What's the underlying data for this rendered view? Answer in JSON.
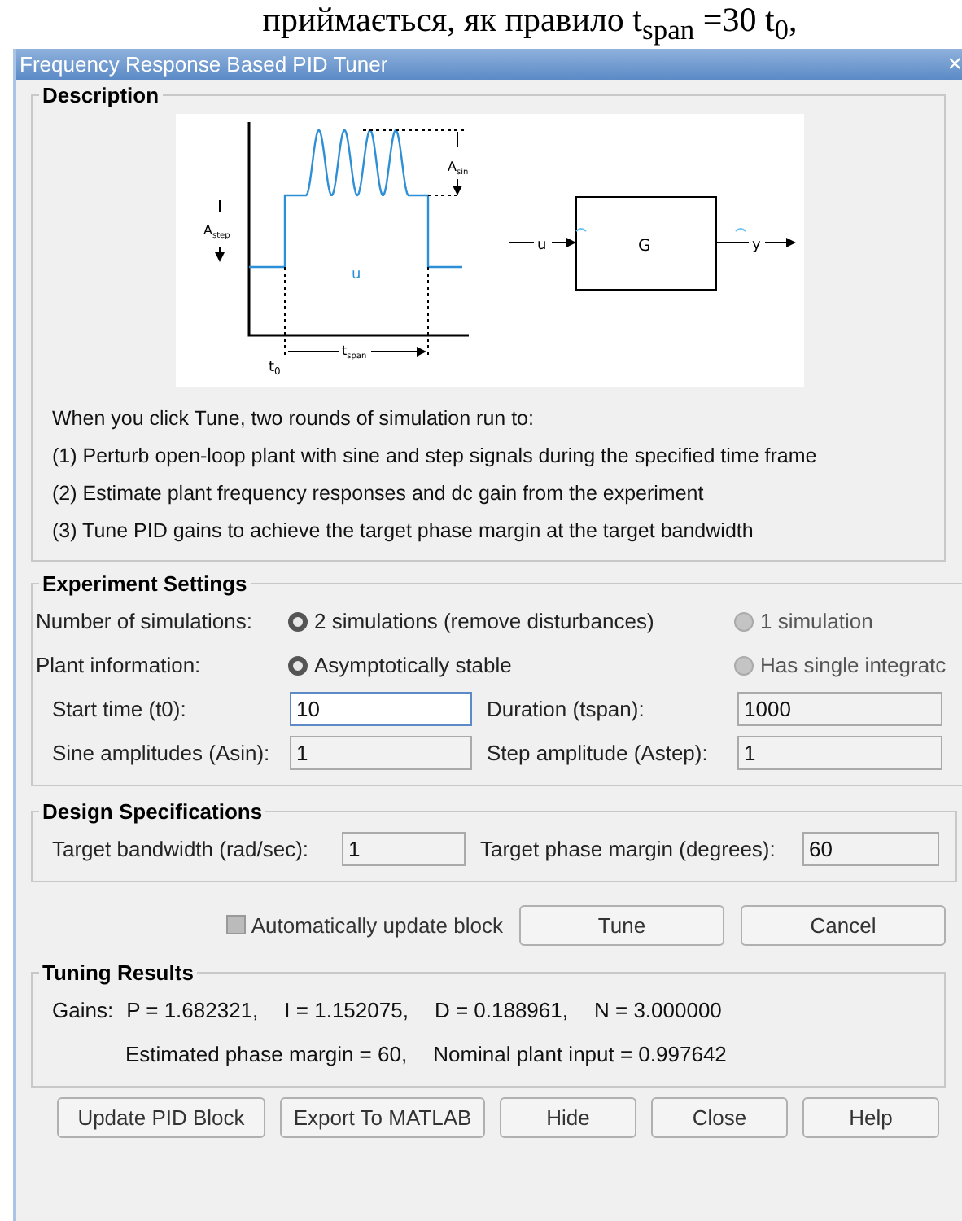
{
  "background_text": "приймається, як правило t$_{span}$ =30 t$_{0}$,",
  "window": {
    "title": "Frequency Response Based PID Tuner",
    "close": "×"
  },
  "description": {
    "title": "Description",
    "diagram_labels": {
      "a_sin": "A",
      "a_sin_sub": "sin",
      "a_step": "A",
      "a_step_sub": "step",
      "u_signal": "u",
      "t_span": "t",
      "t_span_sub": "span",
      "t0": "t",
      "t0_sub": "0",
      "u_input": "u",
      "block": "G",
      "y_output": "y"
    },
    "lines": [
      "When you click Tune, two rounds of simulation run to:",
      "(1) Perturb open-loop plant with sine and step signals during the specified time frame",
      "(2) Estimate plant frequency responses and dc gain from the experiment",
      "(3) Tune PID gains to achieve the target phase margin at the target bandwidth"
    ]
  },
  "experiment": {
    "title": "Experiment Settings",
    "radio_rows": [
      {
        "label": "Number of simulations:",
        "options": [
          {
            "label": "2 simulations (remove disturbances)",
            "selected": true,
            "disabled": false
          },
          {
            "label": "1 simulation",
            "selected": false,
            "disabled": true
          }
        ]
      },
      {
        "label": "Plant information:",
        "options": [
          {
            "label": "Asymptotically stable",
            "selected": true,
            "disabled": false
          },
          {
            "label": "Has single integratc",
            "selected": false,
            "disabled": true
          }
        ]
      }
    ],
    "field_rows": [
      [
        {
          "label": "Start time (t0):",
          "value": "10",
          "focused": true
        },
        {
          "label": "Duration (tspan):",
          "value": "1000",
          "focused": false
        }
      ],
      [
        {
          "label": "Sine amplitudes (Asin):",
          "value": "1",
          "focused": false
        },
        {
          "label": "Step amplitude (Astep):",
          "value": "1",
          "focused": false
        }
      ]
    ]
  },
  "design": {
    "title": "Design Specifications",
    "fields": [
      {
        "label": "Target bandwidth (rad/sec):",
        "value": "1"
      },
      {
        "label": "Target phase margin (degrees):",
        "value": "60"
      }
    ]
  },
  "auto_update": {
    "label": "Automatically update block",
    "checked": false,
    "disabled": true
  },
  "action_buttons": [
    "Tune",
    "Cancel"
  ],
  "results": {
    "title": "Tuning Results",
    "gains_label": "Gains:",
    "gains": [
      "P = 1.682321,",
      "I = 1.152075,",
      "D = 0.188961,",
      "N = 3.000000"
    ],
    "estimates": [
      "Estimated phase margin = 60,",
      "Nominal plant input = 0.997642"
    ]
  },
  "footer_buttons": [
    "Update PID Block",
    "Export To MATLAB",
    "Hide",
    "Close",
    "Help"
  ]
}
